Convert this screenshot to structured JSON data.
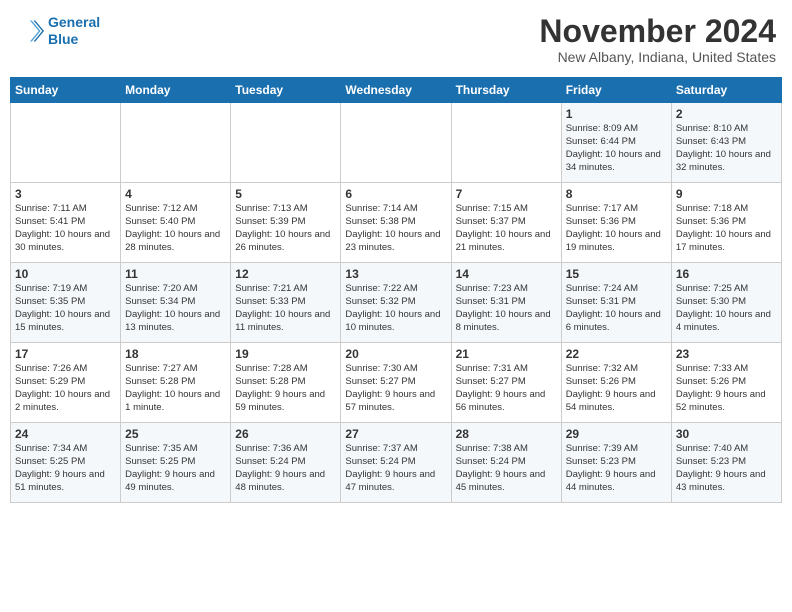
{
  "header": {
    "logo_line1": "General",
    "logo_line2": "Blue",
    "month": "November 2024",
    "location": "New Albany, Indiana, United States"
  },
  "weekdays": [
    "Sunday",
    "Monday",
    "Tuesday",
    "Wednesday",
    "Thursday",
    "Friday",
    "Saturday"
  ],
  "weeks": [
    [
      {
        "day": "",
        "info": ""
      },
      {
        "day": "",
        "info": ""
      },
      {
        "day": "",
        "info": ""
      },
      {
        "day": "",
        "info": ""
      },
      {
        "day": "",
        "info": ""
      },
      {
        "day": "1",
        "info": "Sunrise: 8:09 AM\nSunset: 6:44 PM\nDaylight: 10 hours\nand 34 minutes."
      },
      {
        "day": "2",
        "info": "Sunrise: 8:10 AM\nSunset: 6:43 PM\nDaylight: 10 hours\nand 32 minutes."
      }
    ],
    [
      {
        "day": "3",
        "info": "Sunrise: 7:11 AM\nSunset: 5:41 PM\nDaylight: 10 hours\nand 30 minutes."
      },
      {
        "day": "4",
        "info": "Sunrise: 7:12 AM\nSunset: 5:40 PM\nDaylight: 10 hours\nand 28 minutes."
      },
      {
        "day": "5",
        "info": "Sunrise: 7:13 AM\nSunset: 5:39 PM\nDaylight: 10 hours\nand 26 minutes."
      },
      {
        "day": "6",
        "info": "Sunrise: 7:14 AM\nSunset: 5:38 PM\nDaylight: 10 hours\nand 23 minutes."
      },
      {
        "day": "7",
        "info": "Sunrise: 7:15 AM\nSunset: 5:37 PM\nDaylight: 10 hours\nand 21 minutes."
      },
      {
        "day": "8",
        "info": "Sunrise: 7:17 AM\nSunset: 5:36 PM\nDaylight: 10 hours\nand 19 minutes."
      },
      {
        "day": "9",
        "info": "Sunrise: 7:18 AM\nSunset: 5:36 PM\nDaylight: 10 hours\nand 17 minutes."
      }
    ],
    [
      {
        "day": "10",
        "info": "Sunrise: 7:19 AM\nSunset: 5:35 PM\nDaylight: 10 hours\nand 15 minutes."
      },
      {
        "day": "11",
        "info": "Sunrise: 7:20 AM\nSunset: 5:34 PM\nDaylight: 10 hours\nand 13 minutes."
      },
      {
        "day": "12",
        "info": "Sunrise: 7:21 AM\nSunset: 5:33 PM\nDaylight: 10 hours\nand 11 minutes."
      },
      {
        "day": "13",
        "info": "Sunrise: 7:22 AM\nSunset: 5:32 PM\nDaylight: 10 hours\nand 10 minutes."
      },
      {
        "day": "14",
        "info": "Sunrise: 7:23 AM\nSunset: 5:31 PM\nDaylight: 10 hours\nand 8 minutes."
      },
      {
        "day": "15",
        "info": "Sunrise: 7:24 AM\nSunset: 5:31 PM\nDaylight: 10 hours\nand 6 minutes."
      },
      {
        "day": "16",
        "info": "Sunrise: 7:25 AM\nSunset: 5:30 PM\nDaylight: 10 hours\nand 4 minutes."
      }
    ],
    [
      {
        "day": "17",
        "info": "Sunrise: 7:26 AM\nSunset: 5:29 PM\nDaylight: 10 hours\nand 2 minutes."
      },
      {
        "day": "18",
        "info": "Sunrise: 7:27 AM\nSunset: 5:28 PM\nDaylight: 10 hours\nand 1 minute."
      },
      {
        "day": "19",
        "info": "Sunrise: 7:28 AM\nSunset: 5:28 PM\nDaylight: 9 hours\nand 59 minutes."
      },
      {
        "day": "20",
        "info": "Sunrise: 7:30 AM\nSunset: 5:27 PM\nDaylight: 9 hours\nand 57 minutes."
      },
      {
        "day": "21",
        "info": "Sunrise: 7:31 AM\nSunset: 5:27 PM\nDaylight: 9 hours\nand 56 minutes."
      },
      {
        "day": "22",
        "info": "Sunrise: 7:32 AM\nSunset: 5:26 PM\nDaylight: 9 hours\nand 54 minutes."
      },
      {
        "day": "23",
        "info": "Sunrise: 7:33 AM\nSunset: 5:26 PM\nDaylight: 9 hours\nand 52 minutes."
      }
    ],
    [
      {
        "day": "24",
        "info": "Sunrise: 7:34 AM\nSunset: 5:25 PM\nDaylight: 9 hours\nand 51 minutes."
      },
      {
        "day": "25",
        "info": "Sunrise: 7:35 AM\nSunset: 5:25 PM\nDaylight: 9 hours\nand 49 minutes."
      },
      {
        "day": "26",
        "info": "Sunrise: 7:36 AM\nSunset: 5:24 PM\nDaylight: 9 hours\nand 48 minutes."
      },
      {
        "day": "27",
        "info": "Sunrise: 7:37 AM\nSunset: 5:24 PM\nDaylight: 9 hours\nand 47 minutes."
      },
      {
        "day": "28",
        "info": "Sunrise: 7:38 AM\nSunset: 5:24 PM\nDaylight: 9 hours\nand 45 minutes."
      },
      {
        "day": "29",
        "info": "Sunrise: 7:39 AM\nSunset: 5:23 PM\nDaylight: 9 hours\nand 44 minutes."
      },
      {
        "day": "30",
        "info": "Sunrise: 7:40 AM\nSunset: 5:23 PM\nDaylight: 9 hours\nand 43 minutes."
      }
    ]
  ]
}
